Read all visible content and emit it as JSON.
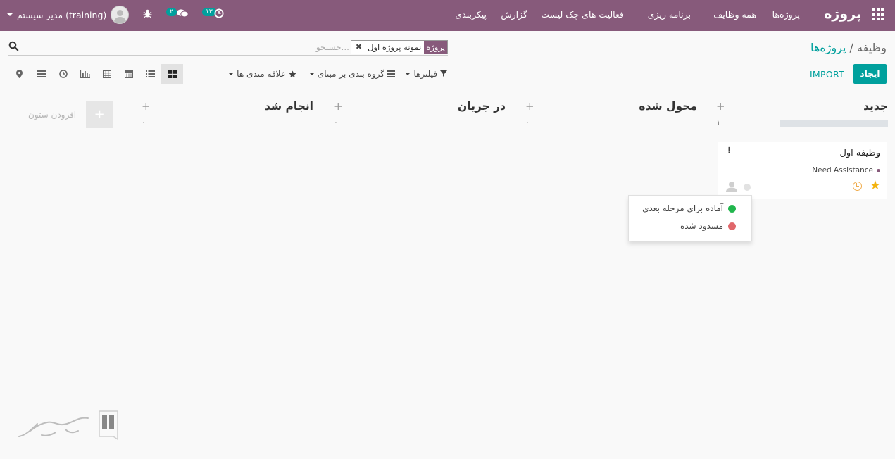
{
  "topbar": {
    "app_title": "پروژه",
    "menu": [
      "پروژه‌ها",
      "همه وظایف",
      "برنامه ریزی",
      "فعالیت های چک لیست",
      "گزارش",
      "پیکربندی"
    ],
    "user_name": "مدیر سیستم (training)",
    "activity_count": "۱۳",
    "message_count": "۲"
  },
  "breadcrumb": {
    "parent": "پروژه‌ها",
    "separator": "/",
    "current": "وظیفه"
  },
  "search": {
    "facet_label": "پروژه",
    "facet_value": "نمونه پروژه اول",
    "placeholder": "جستجو..."
  },
  "controls": {
    "create_label": "ایجاد",
    "import_label": "IMPORT",
    "filters_label": "فیلترها",
    "groupby_label": "گروه بندی بر مبنای",
    "favorites_label": "علاقه مندی ها"
  },
  "view_icons": [
    "kanban-icon",
    "list-icon",
    "calendar-icon",
    "pivot-icon",
    "graph-icon",
    "activity-icon",
    "gantt-icon",
    "map-icon"
  ],
  "columns": [
    {
      "title": "جدید",
      "count": "۱"
    },
    {
      "title": "محول شده",
      "count": "۰"
    },
    {
      "title": "در جریان",
      "count": "۰"
    },
    {
      "title": "انجام شد",
      "count": "۰"
    }
  ],
  "add_column_label": "افزودن ستون",
  "card": {
    "title": "وظیفه اول",
    "tag": "Need Assistance"
  },
  "state_menu": [
    {
      "label": "آماده برای مرحله بعدی",
      "color": "#21b64d"
    },
    {
      "label": "مسدود شده",
      "color": "#e0676b"
    }
  ],
  "colors": {
    "brand": "#875a7b",
    "accent": "#00a09d",
    "star": "#f3b30f"
  }
}
